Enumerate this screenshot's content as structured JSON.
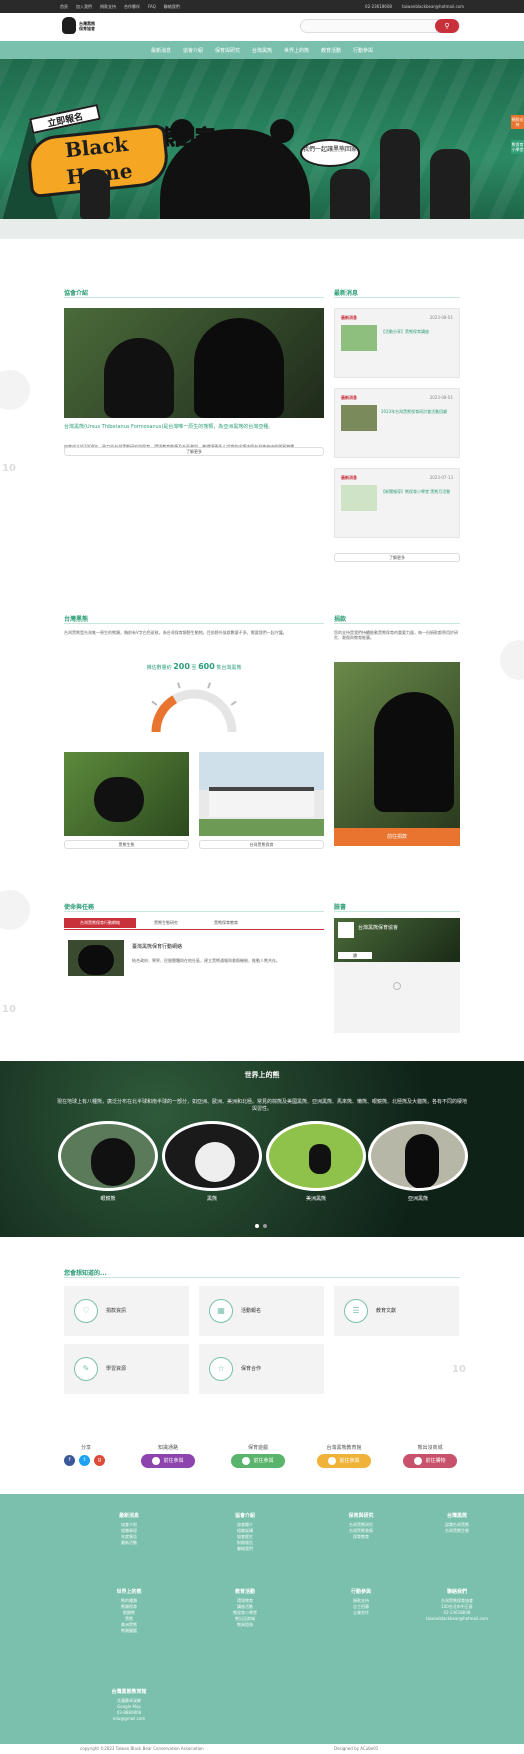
{
  "topbar": {
    "links": [
      "首頁",
      "加入我們",
      "捐款支持",
      "合作夥伴",
      "FAQ",
      "聯絡我們"
    ],
    "phone": "02-23618608",
    "email": "taiwanblackbear@hotmail.com"
  },
  "header": {
    "logo_line1": "台灣黑熊",
    "logo_line2": "保育協會",
    "search_placeholder": "",
    "search_icon": "search-icon"
  },
  "nav": [
    "最新消息",
    "協會介紹",
    "保育與研究",
    "台灣黑熊",
    "世界上的熊",
    "教育活動",
    "行動參與"
  ],
  "hero": {
    "badge": "立即報名",
    "title_en": "Black Home",
    "title_zh": "熊回家",
    "bubble": "我們一起讓黑熊回家",
    "side_tabs": [
      "捐款支持",
      "熊保育小學堂"
    ]
  },
  "about": {
    "title": "協會介紹",
    "heading": "台灣黑熊(Ursus Thibetanus Formosanus)是台灣唯一原生的熊類，為亞洲黑熊的台灣亞種。",
    "body": "協會成立於2008年，致力於台灣黑熊研究與保育、環境教育推廣及社區參與，希望讓更多人認識並守護這個台灣森林中的明星物種。",
    "more": "了解更多"
  },
  "news": {
    "title": "最新消息",
    "items": [
      {
        "tag": "最新消息",
        "date": "2023-08-01",
        "title": "【活動分享】黑熊保育講座"
      },
      {
        "tag": "最新消息",
        "date": "2023-08-01",
        "title": "2023年台灣黑熊保育研討會活動回顧"
      },
      {
        "tag": "最新消息",
        "date": "2023-07-13",
        "title": "【新聞報導】熊保育小學堂 黑熊月活動"
      }
    ],
    "more": "了解更多"
  },
  "taiwan_bear": {
    "title": "台灣黑熊",
    "body": "台灣黑熊是台灣唯一原生的熊類，胸前有V字白色斑紋，為台灣保育類野生動物。目前野外族群數量不多，需要我們一起守護。",
    "estimate_prefix": "推估數量約",
    "estimate_low": "200",
    "estimate_mid": "至",
    "estimate_high": "600",
    "estimate_suffix": "隻台灣黑熊",
    "gauge_level": 0.33,
    "photos": [
      "黑熊生態",
      "台灣黑熊保育"
    ]
  },
  "donate": {
    "title": "捐款",
    "body": "您的支持是我們持續推動黑熊保育的重要力量，每一份捐款都將用於研究、救傷與教育推廣。",
    "button": "前往捐款"
  },
  "mission": {
    "title": "使命與任務",
    "tabs": [
      "台灣黑熊保育行動網絡",
      "黑熊生態研究",
      "黑熊保育教育"
    ],
    "item_title": "臺灣黑熊保育行動網絡",
    "item_body": "結合政府、學界、民間團體與在地社區，建立黑熊通報與救傷機制，推動人熊共存。"
  },
  "facebook": {
    "title": "臉書",
    "page_name": "台灣黑熊保育協會",
    "like": "讚"
  },
  "world": {
    "title": "世界上的熊",
    "body": "現在地球上有八種熊，廣泛分布在北半球和南半球的一部分，如亞洲、歐洲、美洲和北極。常見的棕熊及美國黑熊、亞洲黑熊、馬來熊、懶熊、眼鏡熊、北極熊及大貓熊，各有不同的棲地與習性。",
    "bears": [
      "眼鏡熊",
      "黑熊",
      "美洲黑熊",
      "亞洲黑熊"
    ]
  },
  "know": {
    "title": "您會想知道的...",
    "cards": [
      "捐款資訊",
      "活動報名",
      "教育文獻",
      "學習資源",
      "保育合作"
    ]
  },
  "share": {
    "label": "分享",
    "groups": [
      {
        "label": "知識通路",
        "button": "前往參與",
        "color": "#8e44ad"
      },
      {
        "label": "保育遊戲",
        "button": "前往參與",
        "color": "#5ab46b"
      },
      {
        "label": "台灣黑熊教育館",
        "button": "前往參與",
        "color": "#f0b33a"
      },
      {
        "label": "熊出沒商城",
        "button": "前往購物",
        "color": "#c8526b"
      }
    ]
  },
  "footer": {
    "columns": [
      {
        "title": "最新消息",
        "items": [
          "協會介紹",
          "組織章程",
          "年度報告",
          "最新活動"
        ]
      },
      {
        "title": "協會介紹",
        "items": [
          "協會簡介",
          "組織架構",
          "協會歷史",
          "財務報告",
          "聯絡我們"
        ]
      },
      {
        "title": "保育與研究",
        "items": [
          "台灣黑熊研究",
          "台灣黑熊救傷",
          "保育教育"
        ]
      },
      {
        "title": "台灣黑熊",
        "items": [
          "認識台灣黑熊",
          "台灣黑熊生態"
        ]
      },
      {
        "title": "世界上的熊",
        "items": [
          "熊的種類",
          "熊類保育",
          "眼鏡熊",
          "黑熊",
          "美洲黑熊",
          "熊類圖鑑"
        ]
      },
      {
        "title": "教育活動",
        "items": [
          "環境教育",
          "講座活動",
          "熊保育小學堂",
          "熊出沒商城",
          "教具租借"
        ]
      },
      {
        "title": "行動參與",
        "items": [
          "捐款支持",
          "志工招募",
          "企業合作"
        ]
      },
      {
        "title": "聯絡我們",
        "items": [
          "台灣黑熊保育協會",
          "100台北市中正區",
          "02-23618608",
          "taiwanblackbear@hotmail.com"
        ]
      },
      {
        "title": "台灣黑熊教育館",
        "items": [
          "花蓮縣卓溪鄉",
          "Google Map",
          "03-8880808",
          "edu@gmail.com"
        ]
      }
    ]
  },
  "copyright": {
    "left": "copyright ©2023 Taiwan Black Bear Conservation Association",
    "right": "Designed by ACube01"
  },
  "watermark": "10",
  "colors": {
    "primary": "#7ac0ad",
    "accent": "#2e9e75",
    "red": "#c8313a",
    "orange": "#e8742f"
  }
}
